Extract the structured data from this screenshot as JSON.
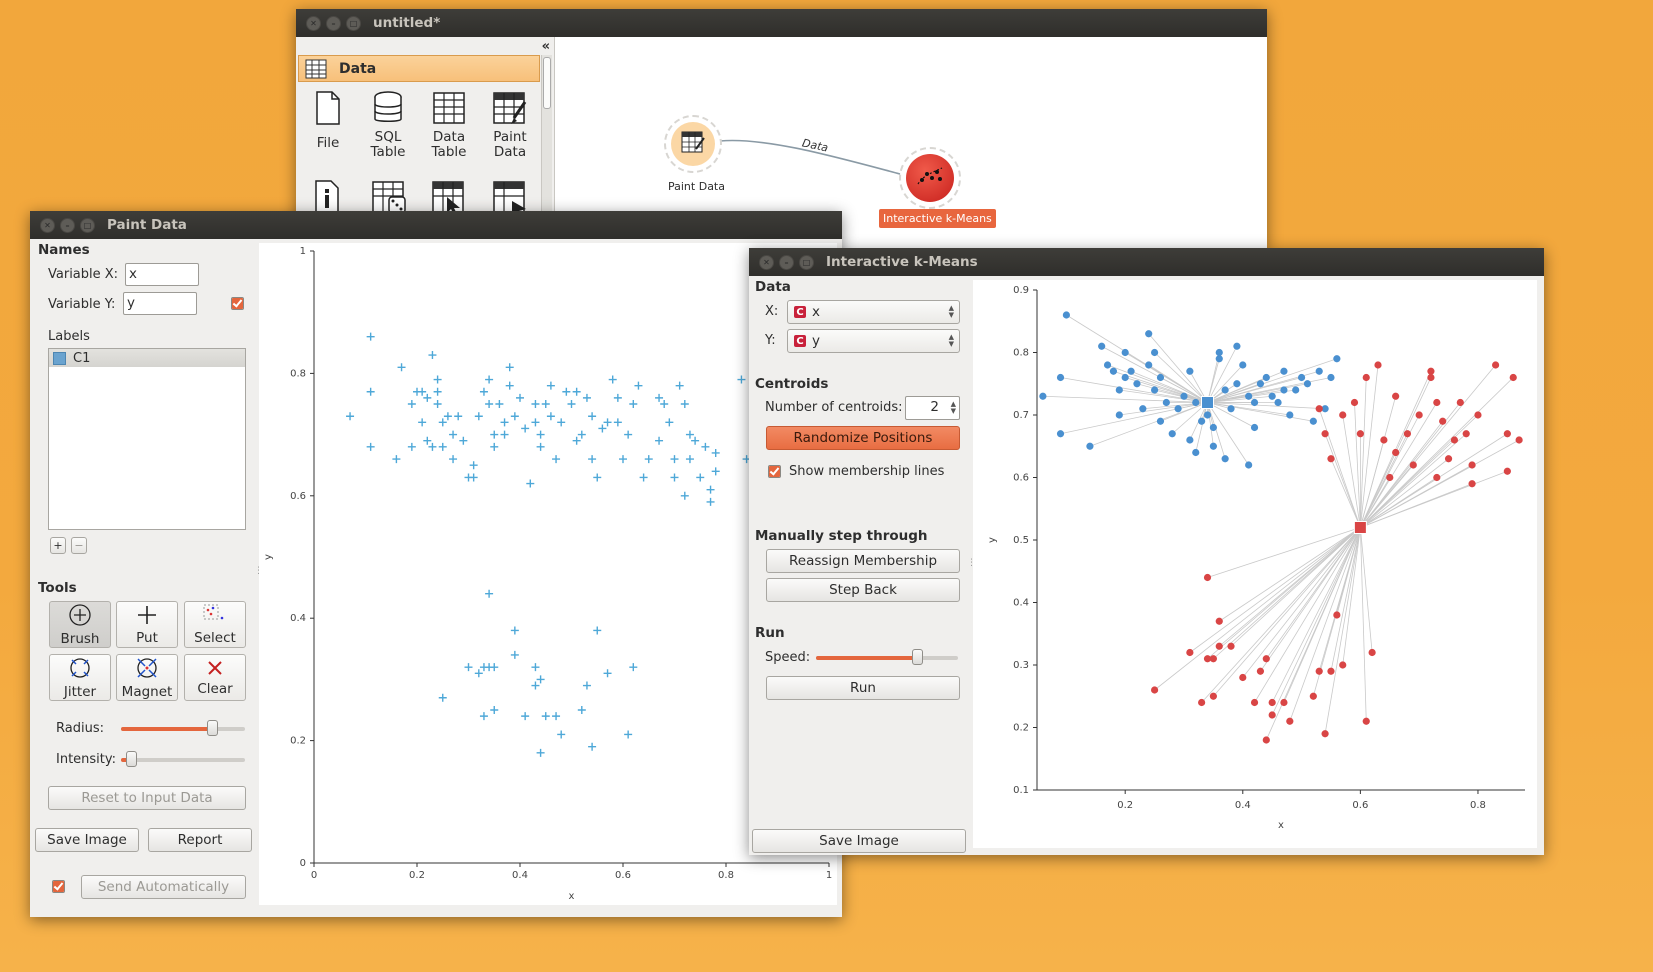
{
  "canvas_window": {
    "title": "untitled*",
    "collapse_glyph": "«",
    "toolbox_category": "Data",
    "widgets": [
      {
        "label_l1": "File",
        "label_l2": "",
        "icon": "file-icon"
      },
      {
        "label_l1": "SQL",
        "label_l2": "Table",
        "icon": "database-icon"
      },
      {
        "label_l1": "Data",
        "label_l2": "Table",
        "icon": "table-icon"
      },
      {
        "label_l1": "Paint",
        "label_l2": "Data",
        "icon": "paint-data-icon"
      }
    ],
    "second_row_icons": [
      "info-icon",
      "random-table-icon",
      "select-table-icon",
      "table-cursor-icon"
    ],
    "nodes": {
      "paint_data": "Paint Data",
      "kmeans": "Interactive k-Means",
      "link_label": "Data"
    }
  },
  "paint_window": {
    "title": "Paint Data",
    "names_section": "Names",
    "var_x_label": "Variable X:",
    "var_x_value": "x",
    "var_y_label": "Variable Y:",
    "var_y_value": "y",
    "labels_section": "Labels",
    "label_item": "C1",
    "add_glyph": "+",
    "remove_glyph": "−",
    "tools_section": "Tools",
    "tools": [
      "Brush",
      "Put",
      "Select",
      "Jitter",
      "Magnet",
      "Clear"
    ],
    "radius_label": "Radius:",
    "radius_level": 0.73,
    "intensity_label": "Intensity:",
    "intensity_level": 0.08,
    "reset_button": "Reset to Input Data",
    "save_image": "Save Image",
    "report": "Report",
    "send_auto": "Send Automatically"
  },
  "kmeans_window": {
    "title": "Interactive k-Means",
    "data_section": "Data",
    "x_label": "X:",
    "x_value": "x",
    "y_label": "Y:",
    "y_value": "y",
    "centroids_section": "Centroids",
    "num_centroids_label": "Number of centroids:",
    "num_centroids_value": "2",
    "randomize_button": "Randomize Positions",
    "show_lines_label": "Show membership lines",
    "manual_section": "Manually step through",
    "reassign_button": "Reassign Membership",
    "step_back_button": "Step Back",
    "run_section": "Run",
    "speed_label": "Speed:",
    "speed_level": 0.71,
    "run_button": "Run",
    "save_image": "Save Image"
  },
  "colors": {
    "accent": "#e4663d",
    "paint_point": "#4ea8d8",
    "cluster_blue": "#4a90d0",
    "cluster_red": "#d94545",
    "background": "#f2a73c"
  },
  "chart_data": [
    {
      "type": "scatter",
      "name": "paint-data-plot",
      "xlabel": "x",
      "ylabel": "y",
      "xlim": [
        0,
        1
      ],
      "ylim": [
        0,
        1
      ],
      "xticks": [
        0,
        0.2,
        0.4,
        0.6,
        0.8,
        1
      ],
      "yticks": [
        0,
        0.2,
        0.4,
        0.6,
        0.8,
        1
      ],
      "marker": "+",
      "points": [
        [
          0.11,
          0.86
        ],
        [
          0.11,
          0.77
        ],
        [
          0.07,
          0.73
        ],
        [
          0.11,
          0.68
        ],
        [
          0.17,
          0.81
        ],
        [
          0.16,
          0.66
        ],
        [
          0.19,
          0.68
        ],
        [
          0.2,
          0.77
        ],
        [
          0.21,
          0.77
        ],
        [
          0.19,
          0.75
        ],
        [
          0.21,
          0.72
        ],
        [
          0.22,
          0.76
        ],
        [
          0.23,
          0.83
        ],
        [
          0.24,
          0.79
        ],
        [
          0.24,
          0.77
        ],
        [
          0.24,
          0.75
        ],
        [
          0.25,
          0.72
        ],
        [
          0.22,
          0.69
        ],
        [
          0.23,
          0.68
        ],
        [
          0.25,
          0.68
        ],
        [
          0.26,
          0.73
        ],
        [
          0.27,
          0.7
        ],
        [
          0.27,
          0.66
        ],
        [
          0.28,
          0.73
        ],
        [
          0.29,
          0.69
        ],
        [
          0.3,
          0.63
        ],
        [
          0.31,
          0.65
        ],
        [
          0.31,
          0.63
        ],
        [
          0.32,
          0.73
        ],
        [
          0.33,
          0.77
        ],
        [
          0.34,
          0.79
        ],
        [
          0.34,
          0.75
        ],
        [
          0.35,
          0.7
        ],
        [
          0.35,
          0.68
        ],
        [
          0.36,
          0.75
        ],
        [
          0.37,
          0.72
        ],
        [
          0.37,
          0.7
        ],
        [
          0.38,
          0.81
        ],
        [
          0.38,
          0.78
        ],
        [
          0.39,
          0.73
        ],
        [
          0.4,
          0.76
        ],
        [
          0.41,
          0.71
        ],
        [
          0.42,
          0.62
        ],
        [
          0.43,
          0.75
        ],
        [
          0.43,
          0.72
        ],
        [
          0.44,
          0.7
        ],
        [
          0.44,
          0.68
        ],
        [
          0.45,
          0.75
        ],
        [
          0.46,
          0.78
        ],
        [
          0.46,
          0.73
        ],
        [
          0.47,
          0.66
        ],
        [
          0.48,
          0.72
        ],
        [
          0.49,
          0.77
        ],
        [
          0.5,
          0.75
        ],
        [
          0.51,
          0.77
        ],
        [
          0.51,
          0.69
        ],
        [
          0.52,
          0.7
        ],
        [
          0.53,
          0.76
        ],
        [
          0.54,
          0.73
        ],
        [
          0.54,
          0.66
        ],
        [
          0.55,
          0.63
        ],
        [
          0.56,
          0.71
        ],
        [
          0.57,
          0.72
        ],
        [
          0.58,
          0.79
        ],
        [
          0.59,
          0.76
        ],
        [
          0.59,
          0.72
        ],
        [
          0.6,
          0.66
        ],
        [
          0.61,
          0.7
        ],
        [
          0.62,
          0.75
        ],
        [
          0.63,
          0.78
        ],
        [
          0.64,
          0.63
        ],
        [
          0.65,
          0.66
        ],
        [
          0.67,
          0.76
        ],
        [
          0.67,
          0.69
        ],
        [
          0.68,
          0.75
        ],
        [
          0.69,
          0.72
        ],
        [
          0.7,
          0.66
        ],
        [
          0.7,
          0.63
        ],
        [
          0.71,
          0.78
        ],
        [
          0.72,
          0.6
        ],
        [
          0.72,
          0.75
        ],
        [
          0.73,
          0.66
        ],
        [
          0.73,
          0.7
        ],
        [
          0.74,
          0.69
        ],
        [
          0.75,
          0.63
        ],
        [
          0.76,
          0.68
        ],
        [
          0.77,
          0.61
        ],
        [
          0.77,
          0.59
        ],
        [
          0.78,
          0.67
        ],
        [
          0.78,
          0.64
        ],
        [
          0.83,
          0.79
        ],
        [
          0.84,
          0.66
        ],
        [
          0.34,
          0.44
        ],
        [
          0.39,
          0.38
        ],
        [
          0.39,
          0.34
        ],
        [
          0.3,
          0.32
        ],
        [
          0.33,
          0.32
        ],
        [
          0.34,
          0.32
        ],
        [
          0.35,
          0.32
        ],
        [
          0.32,
          0.31
        ],
        [
          0.25,
          0.27
        ],
        [
          0.33,
          0.24
        ],
        [
          0.35,
          0.25
        ],
        [
          0.41,
          0.24
        ],
        [
          0.43,
          0.29
        ],
        [
          0.43,
          0.32
        ],
        [
          0.44,
          0.3
        ],
        [
          0.45,
          0.24
        ],
        [
          0.47,
          0.24
        ],
        [
          0.48,
          0.21
        ],
        [
          0.44,
          0.18
        ],
        [
          0.52,
          0.25
        ],
        [
          0.53,
          0.29
        ],
        [
          0.54,
          0.19
        ],
        [
          0.55,
          0.38
        ],
        [
          0.57,
          0.31
        ],
        [
          0.61,
          0.21
        ],
        [
          0.62,
          0.32
        ]
      ]
    },
    {
      "type": "scatter",
      "name": "kmeans-plot",
      "xlabel": "x",
      "ylabel": "y",
      "xlim": [
        0.05,
        0.88
      ],
      "ylim": [
        0.1,
        0.9
      ],
      "xticks": [
        0.2,
        0.4,
        0.6,
        0.8
      ],
      "yticks": [
        0.1,
        0.2,
        0.3,
        0.4,
        0.5,
        0.6,
        0.7,
        0.8,
        0.9
      ],
      "centroids": [
        {
          "cluster": "blue",
          "x": 0.34,
          "y": 0.72
        },
        {
          "cluster": "red",
          "x": 0.6,
          "y": 0.52
        }
      ],
      "series": [
        {
          "cluster": "blue",
          "points": [
            [
              0.06,
              0.73
            ],
            [
              0.1,
              0.86
            ],
            [
              0.09,
              0.76
            ],
            [
              0.09,
              0.67
            ],
            [
              0.14,
              0.65
            ],
            [
              0.16,
              0.81
            ],
            [
              0.17,
              0.78
            ],
            [
              0.18,
              0.77
            ],
            [
              0.19,
              0.7
            ],
            [
              0.2,
              0.8
            ],
            [
              0.2,
              0.76
            ],
            [
              0.21,
              0.77
            ],
            [
              0.22,
              0.75
            ],
            [
              0.23,
              0.71
            ],
            [
              0.24,
              0.83
            ],
            [
              0.24,
              0.78
            ],
            [
              0.25,
              0.8
            ],
            [
              0.25,
              0.74
            ],
            [
              0.26,
              0.76
            ],
            [
              0.27,
              0.72
            ],
            [
              0.28,
              0.67
            ],
            [
              0.29,
              0.71
            ],
            [
              0.3,
              0.73
            ],
            [
              0.31,
              0.66
            ],
            [
              0.31,
              0.77
            ],
            [
              0.32,
              0.64
            ],
            [
              0.33,
              0.69
            ],
            [
              0.34,
              0.7
            ],
            [
              0.35,
              0.65
            ],
            [
              0.36,
              0.79
            ],
            [
              0.37,
              0.74
            ],
            [
              0.38,
              0.71
            ],
            [
              0.39,
              0.75
            ],
            [
              0.4,
              0.78
            ],
            [
              0.41,
              0.73
            ],
            [
              0.42,
              0.68
            ],
            [
              0.43,
              0.75
            ],
            [
              0.44,
              0.76
            ],
            [
              0.45,
              0.73
            ],
            [
              0.46,
              0.72
            ],
            [
              0.47,
              0.77
            ],
            [
              0.48,
              0.7
            ],
            [
              0.49,
              0.74
            ],
            [
              0.5,
              0.76
            ],
            [
              0.51,
              0.75
            ],
            [
              0.52,
              0.69
            ],
            [
              0.53,
              0.77
            ],
            [
              0.54,
              0.71
            ],
            [
              0.55,
              0.76
            ],
            [
              0.56,
              0.79
            ],
            [
              0.41,
              0.62
            ],
            [
              0.37,
              0.63
            ],
            [
              0.36,
              0.8
            ],
            [
              0.39,
              0.81
            ],
            [
              0.19,
              0.74
            ],
            [
              0.26,
              0.69
            ],
            [
              0.32,
              0.72
            ],
            [
              0.35,
              0.68
            ],
            [
              0.42,
              0.72
            ],
            [
              0.47,
              0.74
            ]
          ]
        },
        {
          "cluster": "red",
          "points": [
            [
              0.53,
              0.71
            ],
            [
              0.54,
              0.67
            ],
            [
              0.55,
              0.63
            ],
            [
              0.57,
              0.7
            ],
            [
              0.59,
              0.72
            ],
            [
              0.6,
              0.67
            ],
            [
              0.61,
              0.76
            ],
            [
              0.63,
              0.78
            ],
            [
              0.64,
              0.66
            ],
            [
              0.65,
              0.6
            ],
            [
              0.66,
              0.73
            ],
            [
              0.68,
              0.67
            ],
            [
              0.69,
              0.62
            ],
            [
              0.7,
              0.7
            ],
            [
              0.72,
              0.77
            ],
            [
              0.73,
              0.72
            ],
            [
              0.74,
              0.69
            ],
            [
              0.75,
              0.63
            ],
            [
              0.76,
              0.66
            ],
            [
              0.77,
              0.72
            ],
            [
              0.78,
              0.67
            ],
            [
              0.79,
              0.62
            ],
            [
              0.8,
              0.7
            ],
            [
              0.83,
              0.78
            ],
            [
              0.85,
              0.67
            ],
            [
              0.85,
              0.61
            ],
            [
              0.86,
              0.76
            ],
            [
              0.87,
              0.66
            ],
            [
              0.73,
              0.6
            ],
            [
              0.72,
              0.76
            ],
            [
              0.66,
              0.64
            ],
            [
              0.79,
              0.59
            ],
            [
              0.34,
              0.44
            ],
            [
              0.36,
              0.37
            ],
            [
              0.36,
              0.33
            ],
            [
              0.31,
              0.32
            ],
            [
              0.34,
              0.31
            ],
            [
              0.35,
              0.31
            ],
            [
              0.25,
              0.26
            ],
            [
              0.33,
              0.24
            ],
            [
              0.35,
              0.25
            ],
            [
              0.42,
              0.24
            ],
            [
              0.43,
              0.29
            ],
            [
              0.44,
              0.31
            ],
            [
              0.45,
              0.24
            ],
            [
              0.47,
              0.24
            ],
            [
              0.48,
              0.21
            ],
            [
              0.44,
              0.18
            ],
            [
              0.52,
              0.25
            ],
            [
              0.53,
              0.29
            ],
            [
              0.54,
              0.19
            ],
            [
              0.56,
              0.38
            ],
            [
              0.57,
              0.3
            ],
            [
              0.61,
              0.21
            ],
            [
              0.62,
              0.32
            ],
            [
              0.45,
              0.22
            ],
            [
              0.55,
              0.29
            ],
            [
              0.4,
              0.28
            ],
            [
              0.38,
              0.33
            ]
          ]
        }
      ]
    }
  ]
}
